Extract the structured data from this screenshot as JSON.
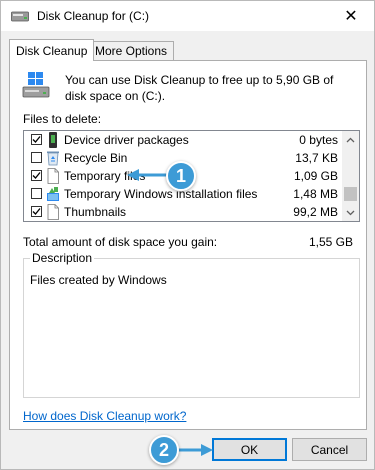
{
  "window": {
    "title": "Disk Cleanup for  (C:)",
    "close_glyph": "✕"
  },
  "tabs": [
    {
      "label": "Disk Cleanup",
      "active": true
    },
    {
      "label": "More Options",
      "active": false
    }
  ],
  "header": {
    "text": "You can use Disk Cleanup to free up to 5,90 GB of disk space on  (C:)."
  },
  "files": {
    "label": "Files to delete:",
    "items": [
      {
        "name": "Device driver packages",
        "size": "0 bytes",
        "checked": true,
        "icon": "device-driver-icon"
      },
      {
        "name": "Recycle Bin",
        "size": "13,7 KB",
        "checked": false,
        "icon": "recycle-bin-icon"
      },
      {
        "name": "Temporary files",
        "size": "1,09 GB",
        "checked": true,
        "icon": "file-icon"
      },
      {
        "name": "Temporary Windows installation files",
        "size": "1,48 MB",
        "checked": false,
        "icon": "windows-installation-icon"
      },
      {
        "name": "Thumbnails",
        "size": "99,2 MB",
        "checked": true,
        "icon": "file-icon"
      }
    ]
  },
  "total": {
    "label": "Total amount of disk space you gain:",
    "value": "1,55 GB"
  },
  "description": {
    "legend": "Description",
    "text": "Files created by Windows"
  },
  "help_link": "How does Disk Cleanup work?",
  "buttons": {
    "ok": "OK",
    "cancel": "Cancel"
  },
  "callouts": [
    {
      "number": "1",
      "points_to": "Temporary files"
    },
    {
      "number": "2",
      "points_to": "OK"
    }
  ],
  "colors": {
    "accent": "#0078d7",
    "callout": "#3d9bd6",
    "link": "#0066cc"
  }
}
